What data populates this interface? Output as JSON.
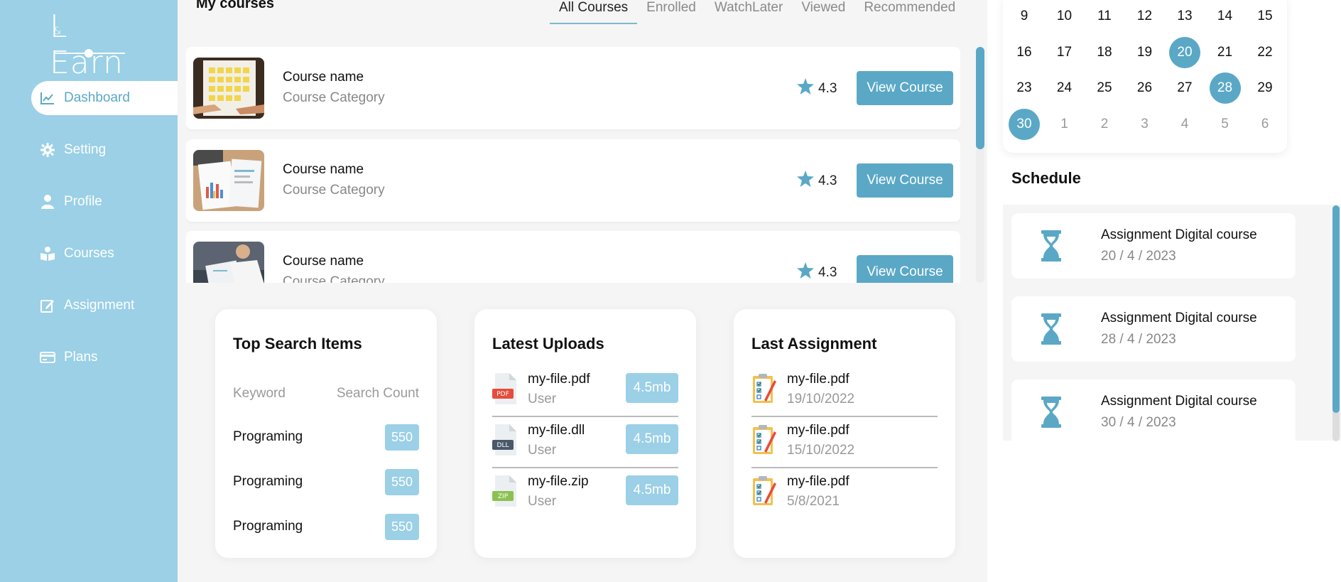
{
  "logo": {
    "text": "LEarn",
    "small": "&"
  },
  "sidebar": {
    "items": [
      {
        "label": "Dashboard",
        "icon": "chart-line-icon",
        "active": true
      },
      {
        "label": "Setting",
        "icon": "gear-icon"
      },
      {
        "label": "Profile",
        "icon": "user-icon"
      },
      {
        "label": "Courses",
        "icon": "book-reader-icon"
      },
      {
        "label": "Assignment",
        "icon": "edit-icon"
      },
      {
        "label": "Plans",
        "icon": "credit-card-icon"
      }
    ]
  },
  "courses": {
    "title": "My courses",
    "tabs": [
      "All Courses",
      "Enrolled",
      "WatchLater",
      "Viewed",
      "Recommended"
    ],
    "active_tab": "All Courses",
    "items": [
      {
        "name": "Course name",
        "category": "Course Category",
        "rating": "4.3",
        "button": "View Course",
        "image": "sticky-notes-photo"
      },
      {
        "name": "Course name",
        "category": "Course Category",
        "rating": "4.3",
        "button": "View Course",
        "image": "charts-papers-photo"
      },
      {
        "name": "Course name",
        "category": "Course Category",
        "rating": "4.3",
        "button": "View Course",
        "image": "person-writing-photo"
      }
    ]
  },
  "top_search": {
    "title": "Top Search Items",
    "col_keyword": "Keyword",
    "col_count": "Search Count",
    "rows": [
      {
        "keyword": "Programing",
        "count": "550"
      },
      {
        "keyword": "Programing",
        "count": "550"
      },
      {
        "keyword": "Programing",
        "count": "550"
      }
    ]
  },
  "latest_uploads": {
    "title": "Latest Uploads",
    "files": [
      {
        "name": "my-file.pdf",
        "sub": "User",
        "size": "4.5mb",
        "type": "PDF",
        "color": "#e74c3c"
      },
      {
        "name": "my-file.dll",
        "sub": "User",
        "size": "4.5mb",
        "type": "DLL",
        "color": "#4a5968"
      },
      {
        "name": "my-file.zip",
        "sub": "User",
        "size": "4.5mb",
        "type": "ZIP",
        "color": "#8cc152"
      }
    ]
  },
  "last_assignment": {
    "title": "Last Assignment",
    "items": [
      {
        "name": "my-file.pdf",
        "date": "19/10/2022"
      },
      {
        "name": "my-file.pdf",
        "date": "15/10/2022"
      },
      {
        "name": "my-file.pdf",
        "date": "5/8/2021"
      }
    ]
  },
  "calendar": {
    "rows": [
      [
        "9",
        "10",
        "11",
        "12",
        "13",
        "14",
        "15"
      ],
      [
        "16",
        "17",
        "18",
        "19",
        "20",
        "21",
        "22"
      ],
      [
        "23",
        "24",
        "25",
        "26",
        "27",
        "28",
        "29"
      ],
      [
        "30",
        "1",
        "2",
        "3",
        "4",
        "5",
        "6"
      ]
    ],
    "selected": [
      "20",
      "28",
      "30"
    ]
  },
  "schedule": {
    "title": "Schedule",
    "items": [
      {
        "title": "Assignment Digital course",
        "date": "20 / 4 / 2023"
      },
      {
        "title": "Assignment Digital course",
        "date": "28 / 4 / 2023"
      },
      {
        "title": "Assignment Digital course",
        "date": "30 / 4 / 2023"
      }
    ]
  },
  "colors": {
    "accent": "#5aa8c6",
    "sidebar": "#9bd0e6",
    "badge": "#9bd0e6"
  }
}
